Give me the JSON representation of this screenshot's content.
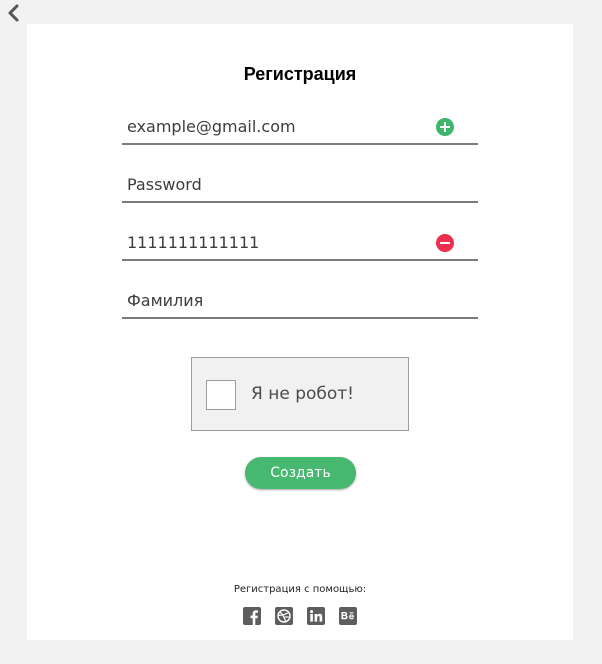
{
  "form": {
    "title": "Регистрация",
    "fields": [
      {
        "value": "example@gmail.com",
        "placeholder": "",
        "status": "valid"
      },
      {
        "value": "",
        "placeholder": "Password",
        "status": "none"
      },
      {
        "value": "1111111111111",
        "placeholder": "",
        "status": "invalid"
      },
      {
        "value": "",
        "placeholder": "Фамилия",
        "status": "none"
      }
    ],
    "captcha_label": "Я не робот!",
    "captcha_checked": false,
    "submit_label": "Создать",
    "social_caption": "Регистрация с помощью:",
    "social_networks": [
      "facebook",
      "dribbble",
      "linkedin",
      "behance"
    ]
  },
  "icons": {
    "back": "chevron-left-icon",
    "valid": "plus-circle-icon",
    "invalid": "minus-circle-icon"
  },
  "colors": {
    "background": "#f2f2f2",
    "card": "#ffffff",
    "accent_green": "#47b870",
    "valid_icon": "#3fb56c",
    "error_icon": "#ee2f4d",
    "underline": "#7c7c7c",
    "social_icon": "#5e5e5e"
  }
}
